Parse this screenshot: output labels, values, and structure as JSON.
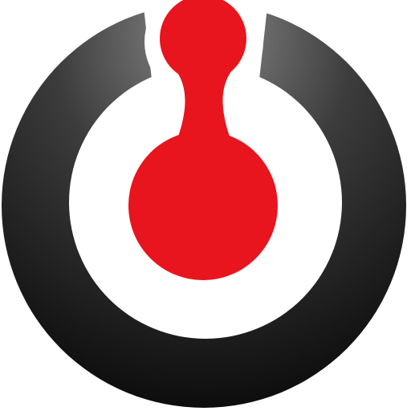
{
  "logo": {
    "icon_name": "ring-with-red-figure-logo",
    "colors": {
      "background": "#ffffff",
      "ring_light": "#8a8a8a",
      "ring_mid": "#3c3c3c",
      "ring_dark": "#0d0d0d",
      "inner_disc": "#ffffff",
      "figure_red": "#e8141e"
    }
  }
}
